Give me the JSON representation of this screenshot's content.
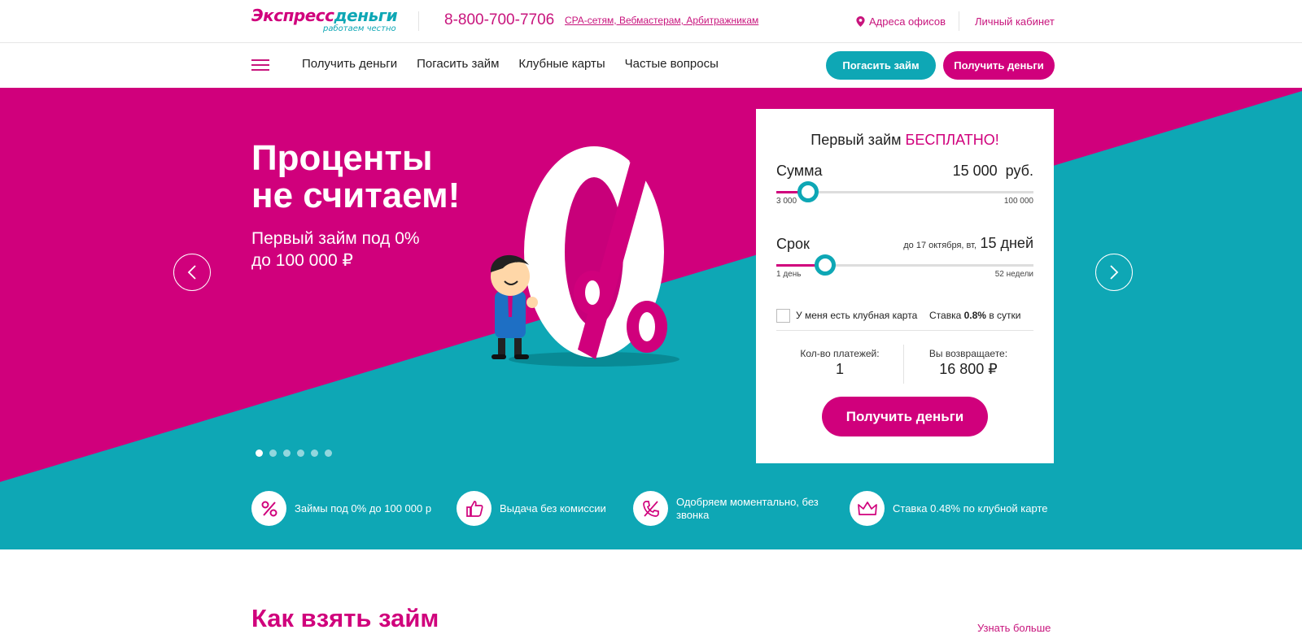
{
  "header": {
    "logo": {
      "part1": "Экспресс",
      "part2": "деньги",
      "tagline": "работаем честно"
    },
    "phone": "8-800-700-7706",
    "cpa_link": "CPA-сетям, Вебмастерам, Арбитражникам",
    "offices_link": "Адреса офисов",
    "cabinet_link": "Личный кабинет"
  },
  "nav": {
    "items": [
      "Получить деньги",
      "Погасить займ",
      "Клубные карты",
      "Частые вопросы"
    ],
    "repay_button": "Погасить займ",
    "get_button": "Получить деньги"
  },
  "hero": {
    "title_line1": "Проценты",
    "title_line2": "не считаем!",
    "sub_line1": "Первый займ под 0%",
    "sub_line2": "до 100 000 ₽",
    "slide_count": 6,
    "active_slide": 1
  },
  "calculator": {
    "title_prefix": "Первый займ",
    "title_highlight": "БЕСПЛАТНО!",
    "amount": {
      "label": "Сумма",
      "value": "15 000",
      "unit": "руб.",
      "min_label": "3 000",
      "max_label": "100 000",
      "min": 3000,
      "max": 100000,
      "current": 15000
    },
    "term": {
      "label": "Срок",
      "date_text": "до 17 октября, вт,",
      "value": "15 дней",
      "min_label": "1 день",
      "max_label": "52 недели",
      "level": 0.19
    },
    "club_card_label": "У меня есть клубная карта",
    "rate_prefix": "Ставка",
    "rate_value": "0.8%",
    "rate_suffix": "в сутки",
    "payments_label": "Кол-во платежей:",
    "payments_value": "1",
    "return_label": "Вы возвращаете:",
    "return_value": "16 800 ₽",
    "submit_button": "Получить деньги"
  },
  "features": [
    {
      "icon": "percent-icon",
      "text": "Займы под 0% до 100 000 р"
    },
    {
      "icon": "thumbs-up-icon",
      "text": "Выдача без комиссии"
    },
    {
      "icon": "phone-crossed-icon",
      "text": "Одобряем моментально, без звонка"
    },
    {
      "icon": "crown-icon",
      "text": "Ставка 0.48% по клубной карте"
    }
  ],
  "section": {
    "title": "Как взять займ",
    "more_link": "Узнать больше"
  },
  "colors": {
    "brand_pink": "#d0007c",
    "brand_teal": "#0ea7b5"
  }
}
